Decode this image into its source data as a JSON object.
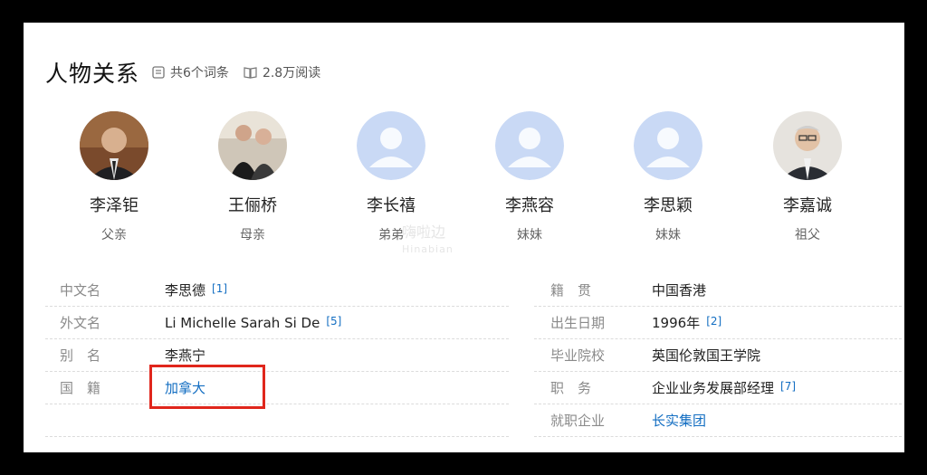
{
  "header": {
    "title": "人物关系",
    "entries_count": "共6个词条",
    "read_count": "2.8万阅读"
  },
  "people": [
    {
      "name": "李泽钜",
      "relation": "父亲",
      "avatar": "photo"
    },
    {
      "name": "王俪桥",
      "relation": "母亲",
      "avatar": "photo"
    },
    {
      "name": "李长禧",
      "relation": "弟弟",
      "avatar": "placeholder"
    },
    {
      "name": "李燕容",
      "relation": "妹妹",
      "avatar": "placeholder"
    },
    {
      "name": "李思颖",
      "relation": "妹妹",
      "avatar": "placeholder"
    },
    {
      "name": "李嘉诚",
      "relation": "祖父",
      "avatar": "photo"
    }
  ],
  "watermark": {
    "text": "嗨啦边",
    "sub": "Hinabian"
  },
  "info_left": [
    {
      "label": "中文名",
      "value": "李思德",
      "ref": "[1]",
      "link": false
    },
    {
      "label": "外文名",
      "value": "Li Michelle Sarah Si De",
      "ref": "[5]",
      "link": false
    },
    {
      "label": "别　名",
      "value": "李燕宁",
      "ref": "",
      "link": false
    },
    {
      "label": "国　籍",
      "value": "加拿大",
      "ref": "",
      "link": true
    }
  ],
  "info_right": [
    {
      "label": "籍　贯",
      "value": "中国香港",
      "ref": "",
      "link": false
    },
    {
      "label": "出生日期",
      "value": "1996年",
      "ref": "[2]",
      "link": false
    },
    {
      "label": "毕业院校",
      "value": "英国伦敦国王学院",
      "ref": "",
      "link": false
    },
    {
      "label": "职　务",
      "value": "企业业务发展部经理",
      "ref": "[7]",
      "link": false
    },
    {
      "label": "就职企业",
      "value": "长实集团",
      "ref": "",
      "link": true
    }
  ],
  "colors": {
    "link": "#136ec2",
    "highlight": "#e0261c",
    "placeholder_avatar": "#c9d9f5"
  }
}
